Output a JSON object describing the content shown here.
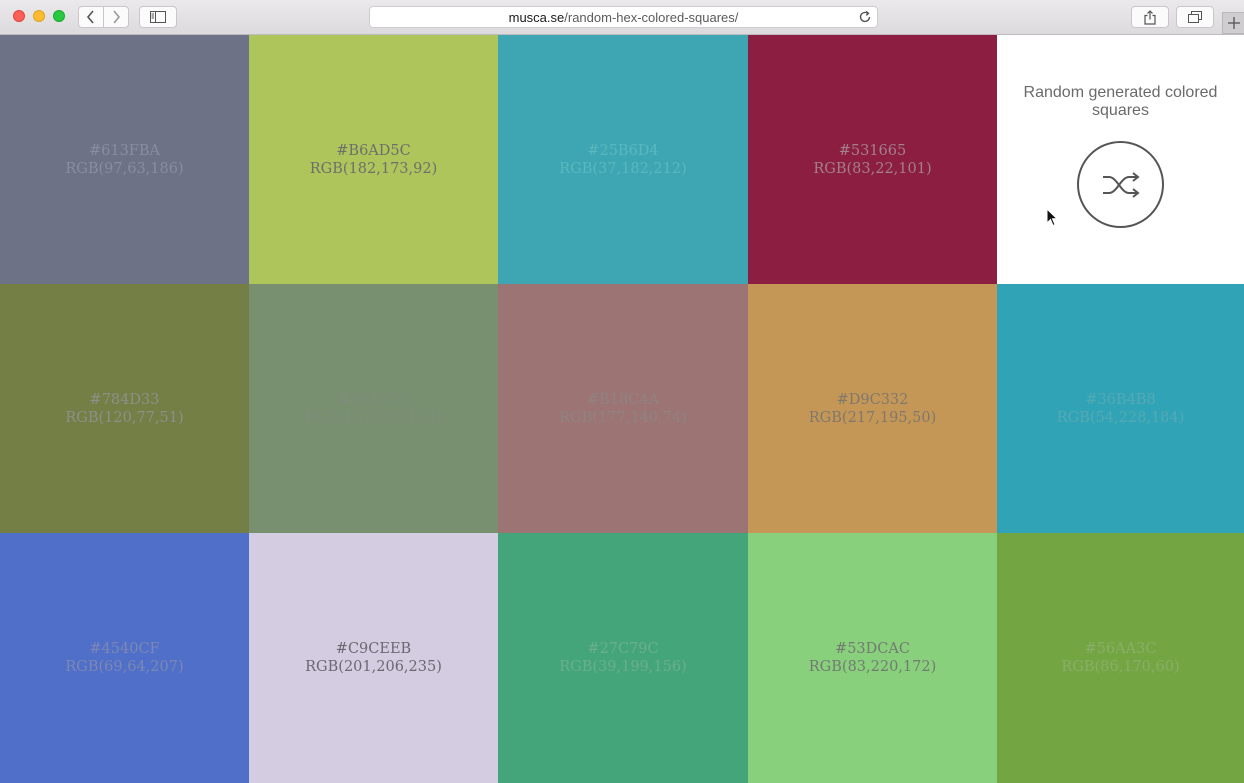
{
  "browser": {
    "url_domain": "musca.se",
    "url_path": "/random-hex-colored-squares/",
    "colors": {
      "close": "#fd5f57",
      "minimize": "#febc2e",
      "maximize": "#28c840"
    }
  },
  "hero": {
    "title": "Random generated colored squares",
    "shuffle_icon": "shuffle-icon"
  },
  "tiles": [
    {
      "hex": "#613FBA",
      "rgb": "RGB(97,63,186)",
      "bg": "#6d7287",
      "fg": "#8a8da0"
    },
    {
      "hex": "#B6AD5C",
      "rgb": "RGB(182,173,92)",
      "bg": "#aec55c",
      "fg": "#6e6f6a"
    },
    {
      "hex": "#25B6D4",
      "rgb": "RGB(37,182,212)",
      "bg": "#3ea6b3",
      "fg": "#5ab7be"
    },
    {
      "hex": "#531665",
      "rgb": "RGB(83,22,101)",
      "bg": "#8b1e41",
      "fg": "#a47f8d"
    },
    {
      "hex": "#784D33",
      "rgb": "RGB(120,77,51)",
      "bg": "#737f45",
      "fg": "#8e8f8a"
    },
    {
      "hex": "#89A37C",
      "rgb": "RGB(137,163,124)",
      "bg": "#78906f",
      "fg": "#7f8d7d"
    },
    {
      "hex": "#B18C4A",
      "rgb": "RGB(177,140,74)",
      "bg": "#9c7473",
      "fg": "#8f8384"
    },
    {
      "hex": "#D9C332",
      "rgb": "RGB(217,195,50)",
      "bg": "#c59756",
      "fg": "#80776d"
    },
    {
      "hex": "#36B4B8",
      "rgb": "RGB(54,228,184)",
      "bg": "#30a3b6",
      "fg": "#55a9b3"
    },
    {
      "hex": "#4540CF",
      "rgb": "RGB(69,64,207)",
      "bg": "#506fc9",
      "fg": "#7c88b3"
    },
    {
      "hex": "#C9CEEB",
      "rgb": "RGB(201,206,235)",
      "bg": "#d4cce0",
      "fg": "#6a6870"
    },
    {
      "hex": "#27C79C",
      "rgb": "RGB(39,199,156)",
      "bg": "#45a57a",
      "fg": "#6aae8e"
    },
    {
      "hex": "#53DCAC",
      "rgb": "RGB(83,220,172)",
      "bg": "#89d07c",
      "fg": "#727a72"
    },
    {
      "hex": "#56AA3C",
      "rgb": "RGB(86,170,60)",
      "bg": "#73a542",
      "fg": "#8aae6a"
    }
  ]
}
